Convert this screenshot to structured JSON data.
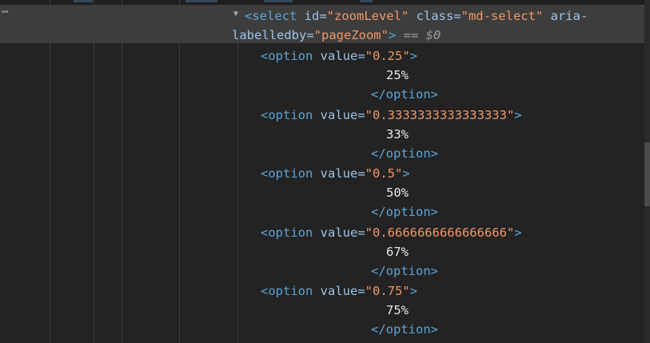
{
  "overflow_menu": "⋯",
  "select_line": {
    "open": "<select",
    "id_attr": " id=",
    "id_val": "\"zoomLevel\"",
    "class_attr": " class=",
    "class_val": "\"md-select\"",
    "aria_attr_part1": " aria-",
    "aria_attr_part2": "labelledby=",
    "aria_val": "\"pageZoom\"",
    "close": ">",
    "eq": " == ",
    "dollar": "$0"
  },
  "options": [
    {
      "open": "<option",
      "attr": " value=",
      "value": "\"0.25\"",
      "gt": ">",
      "label": "25%",
      "close": "</option>"
    },
    {
      "open": "<option",
      "attr": " value=",
      "value": "\"0.3333333333333333\"",
      "gt": ">",
      "label": "33%",
      "close": "</option>"
    },
    {
      "open": "<option",
      "attr": " value=",
      "value": "\"0.5\"",
      "gt": ">",
      "label": "50%",
      "close": "</option>"
    },
    {
      "open": "<option",
      "attr": " value=",
      "value": "\"0.6666666666666666\"",
      "gt": ">",
      "label": "67%",
      "close": "</option>"
    },
    {
      "open": "<option",
      "attr": " value=",
      "value": "\"0.75\"",
      "gt": ">",
      "label": "75%",
      "close": "</option>"
    }
  ],
  "icons": {
    "expand": "expanded-triangle-icon"
  },
  "colors": {
    "background": "#232323",
    "selected_row": "#3d3d3d",
    "tag": "#5da4d6",
    "attribute": "#9ec4e6",
    "value": "#f29766",
    "text": "#e8e8e8"
  }
}
